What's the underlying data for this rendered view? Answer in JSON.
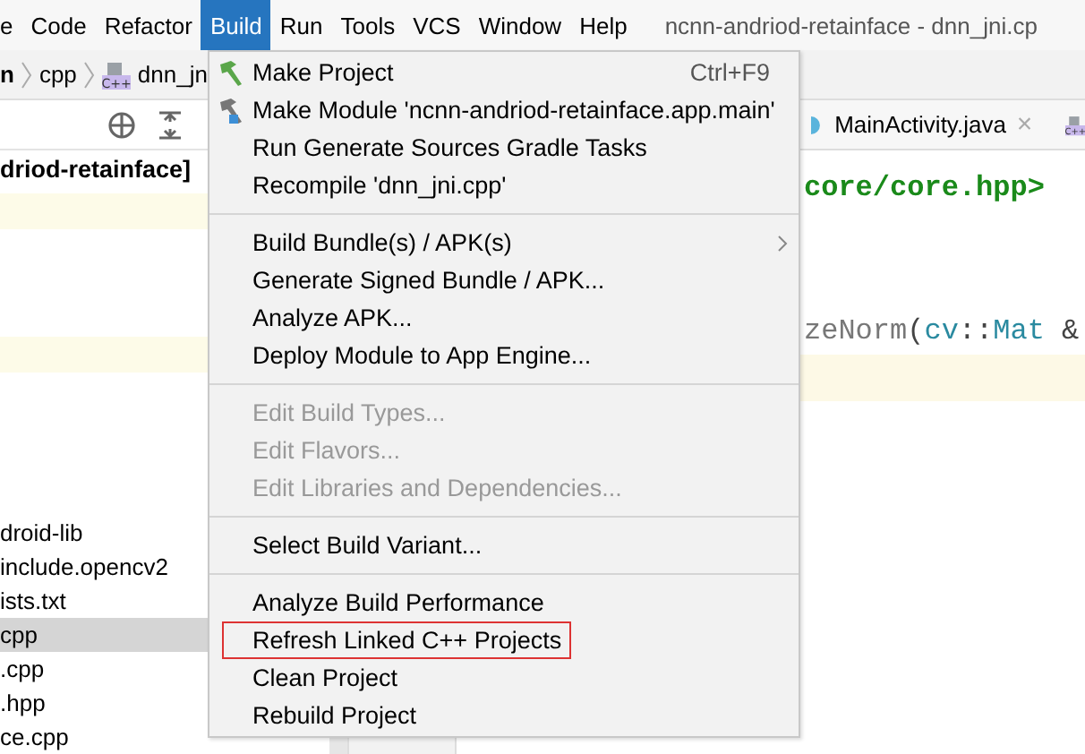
{
  "menubar": {
    "items": [
      {
        "label": "e",
        "selected": false
      },
      {
        "label": "Code",
        "selected": false
      },
      {
        "label": "Refactor",
        "selected": false
      },
      {
        "label": "Build",
        "selected": true
      },
      {
        "label": "Run",
        "selected": false
      },
      {
        "label": "Tools",
        "selected": false
      },
      {
        "label": "VCS",
        "selected": false
      },
      {
        "label": "Window",
        "selected": false
      },
      {
        "label": "Help",
        "selected": false
      }
    ],
    "title": "ncnn-andriod-retainface - dnn_jni.cp"
  },
  "breadcrumb": [
    "n",
    "cpp",
    "dnn_jn"
  ],
  "breadcrumb_icon_label": "C++",
  "project_panel": {
    "root": "driod-retainface]",
    "items": [
      {
        "label": "droid-lib",
        "selected": false
      },
      {
        "label": "include.opencv2",
        "selected": false
      },
      {
        "label": "ists.txt",
        "selected": false
      },
      {
        "label": "cpp",
        "selected": true
      },
      {
        "label": ".cpp",
        "selected": false
      },
      {
        "label": ".hpp",
        "selected": false
      },
      {
        "label": "ce.cpp",
        "selected": false
      }
    ]
  },
  "editor": {
    "tab": "MainActivity.java",
    "tab_close": "×",
    "next_tab_icon_label": "C++",
    "lines": [
      [
        {
          "text": "core/core.hpp>",
          "kind": "string"
        }
      ],
      [
        {
          "text": "zeNorm",
          "kind": "ident"
        },
        {
          "text": "(",
          "kind": "punct"
        },
        {
          "text": "cv",
          "kind": "type"
        },
        {
          "text": "::",
          "kind": "punct"
        },
        {
          "text": "Mat",
          "kind": "type"
        },
        {
          "text": " &",
          "kind": "punct"
        }
      ]
    ]
  },
  "build_menu": [
    {
      "kind": "item-hammer",
      "label": "Make Project",
      "shortcut": "Ctrl+F9",
      "disabled": false,
      "outlined": false
    },
    {
      "kind": "item-module",
      "label": "Make Module 'ncnn-andriod-retainface.app.main'",
      "disabled": false,
      "outlined": false
    },
    {
      "kind": "item",
      "label": "Run Generate Sources Gradle Tasks",
      "disabled": false,
      "outlined": false
    },
    {
      "kind": "item",
      "label": "Recompile 'dnn_jni.cpp'",
      "disabled": false,
      "outlined": false
    },
    {
      "kind": "separator"
    },
    {
      "kind": "item",
      "label": "Build Bundle(s) / APK(s)",
      "submenu": true,
      "disabled": false,
      "outlined": false
    },
    {
      "kind": "item",
      "label": "Generate Signed Bundle / APK...",
      "disabled": false,
      "outlined": false
    },
    {
      "kind": "item",
      "label": "Analyze APK...",
      "disabled": false,
      "outlined": false
    },
    {
      "kind": "item",
      "label": "Deploy Module to App Engine...",
      "disabled": false,
      "outlined": false
    },
    {
      "kind": "separator"
    },
    {
      "kind": "item",
      "label": "Edit Build Types...",
      "disabled": true,
      "outlined": false
    },
    {
      "kind": "item",
      "label": "Edit Flavors...",
      "disabled": true,
      "outlined": false
    },
    {
      "kind": "item",
      "label": "Edit Libraries and Dependencies...",
      "disabled": true,
      "outlined": false
    },
    {
      "kind": "separator"
    },
    {
      "kind": "item",
      "label": "Select Build Variant...",
      "disabled": false,
      "outlined": false
    },
    {
      "kind": "separator"
    },
    {
      "kind": "item",
      "label": "Analyze Build Performance",
      "disabled": false,
      "outlined": false
    },
    {
      "kind": "item",
      "label": "Refresh Linked C++ Projects",
      "disabled": false,
      "outlined": true
    },
    {
      "kind": "item",
      "label": "Clean Project",
      "disabled": false,
      "outlined": false
    },
    {
      "kind": "item",
      "label": "Rebuild Project",
      "disabled": false,
      "outlined": false
    }
  ]
}
